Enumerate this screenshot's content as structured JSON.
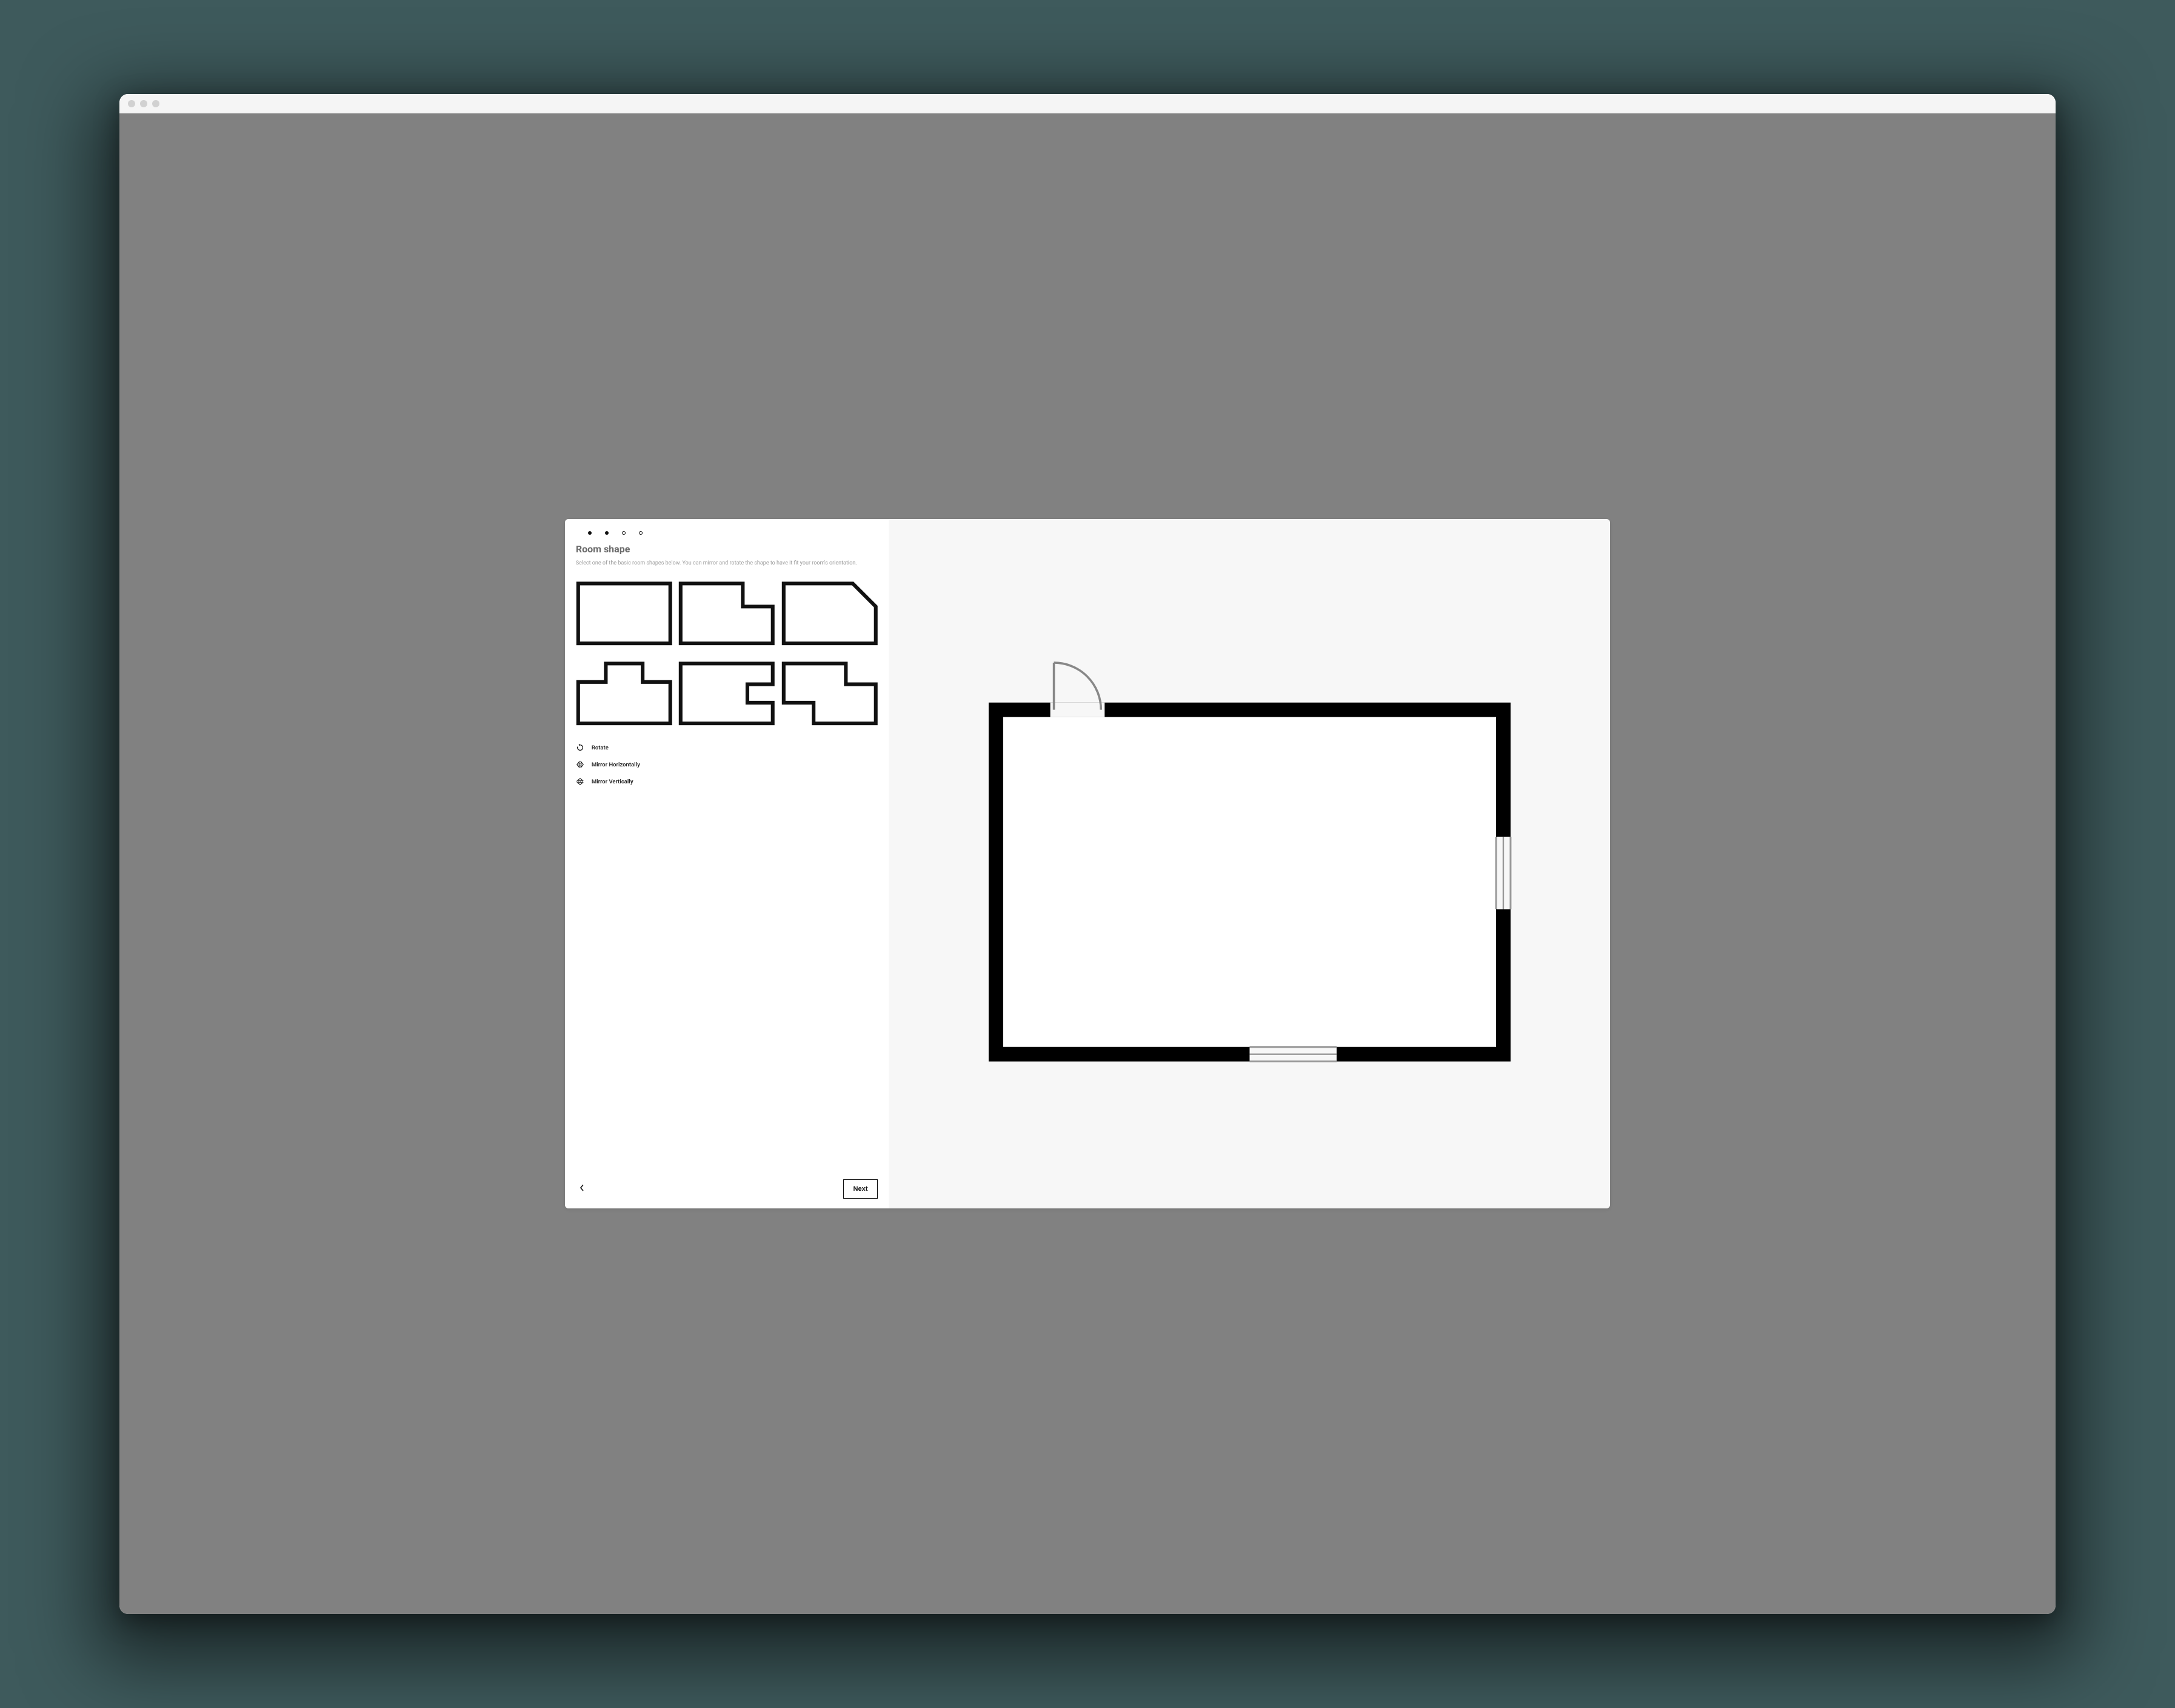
{
  "dialog": {
    "title": "Room shape",
    "description": "Select one of the basic room shapes below. You can mirror and rotate the shape to have it fit your room's orientation.",
    "stepper": {
      "total": 4,
      "filled": 2
    },
    "shapes": [
      {
        "name": "rectangle"
      },
      {
        "name": "l-shape-top-right-notch"
      },
      {
        "name": "angled-corner"
      },
      {
        "name": "t-shape-top-notch"
      },
      {
        "name": "c-shape-right-notch"
      },
      {
        "name": "s-shape-step"
      }
    ],
    "actions": {
      "rotate": "Rotate",
      "mirror_h": "Mirror Horizontally",
      "mirror_v": "Mirror Vertically"
    },
    "buttons": {
      "next": "Next"
    }
  }
}
